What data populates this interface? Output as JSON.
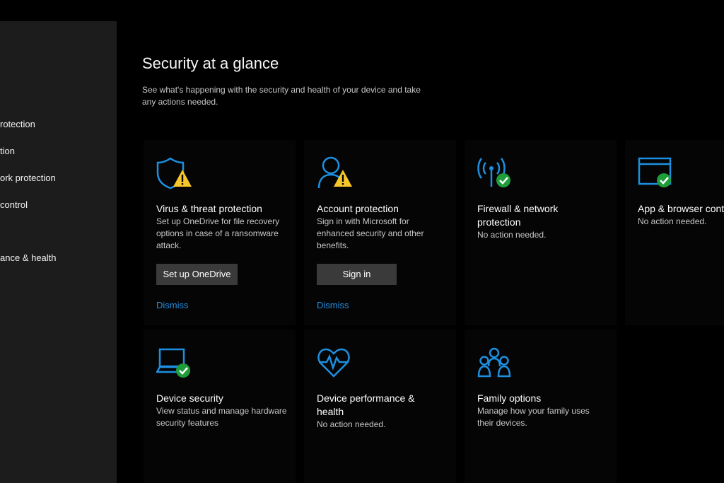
{
  "sidebar": {
    "items": [
      {
        "label": "rotection"
      },
      {
        "label": "tion"
      },
      {
        "label": "ork protection"
      },
      {
        "label": "control"
      },
      {
        "label": "ance & health"
      }
    ]
  },
  "main": {
    "title": "Security at a glance",
    "subtitle": "See what's happening with the security and health of your device and take any actions needed."
  },
  "tiles": {
    "virus": {
      "icon": "shield-warning-icon",
      "title": "Virus & threat protection",
      "desc": "Set up OneDrive for file recovery options in case of a ransomware attack.",
      "button": "Set up OneDrive",
      "link": "Dismiss"
    },
    "account": {
      "icon": "person-warning-icon",
      "title": "Account protection",
      "desc": "Sign in with Microsoft for enhanced security and other benefits.",
      "button": "Sign in",
      "link": "Dismiss"
    },
    "firewall": {
      "icon": "wireless-antenna-check-icon",
      "title": "Firewall & network protection",
      "desc": "No action needed."
    },
    "appbrowser": {
      "icon": "browser-window-check-icon",
      "title": "App & browser control",
      "desc": "No action needed."
    },
    "devicesecurity": {
      "icon": "laptop-check-icon",
      "title": "Device security",
      "desc": "View status and manage hardware security features"
    },
    "performance": {
      "icon": "heart-pulse-icon",
      "title": "Device performance & health",
      "desc": "No action needed."
    },
    "family": {
      "icon": "family-group-icon",
      "title": "Family options",
      "desc": "Manage how your family uses their devices."
    }
  },
  "colors": {
    "accent_blue": "#1e8fe0",
    "warning_yellow": "#f7c72a",
    "ok_green": "#1f9d3a",
    "sidebar_bg": "#1c1c1c",
    "main_bg": "#000000"
  }
}
